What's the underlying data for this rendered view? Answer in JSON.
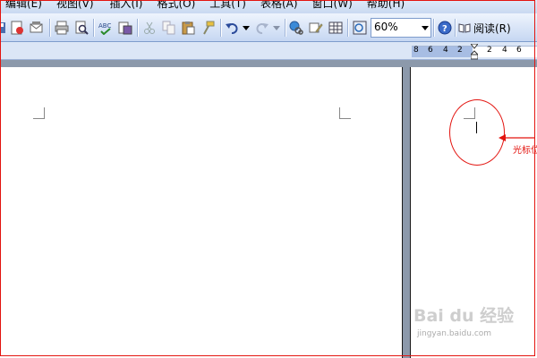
{
  "menu": {
    "items": [
      "编辑(E)",
      "视图(V)",
      "插入(I)",
      "格式(O)",
      "工具(T)",
      "表格(A)",
      "窗口(W)",
      "帮助(H)"
    ]
  },
  "toolbar": {
    "zoom_value": "60%",
    "read_label": "阅读(R)"
  },
  "ruler": {
    "labels": [
      "8",
      "6",
      "4",
      "2",
      "2",
      "4",
      "6"
    ]
  },
  "annotation": {
    "label": "光标位"
  },
  "watermark": {
    "main": "Bai du 经验",
    "sub": "jingyan.baidu.com"
  },
  "colors": {
    "annotation_red": "#e3140f",
    "toolbar_blue": "#c6d7f2",
    "workspace_gray": "#8c99ab"
  }
}
